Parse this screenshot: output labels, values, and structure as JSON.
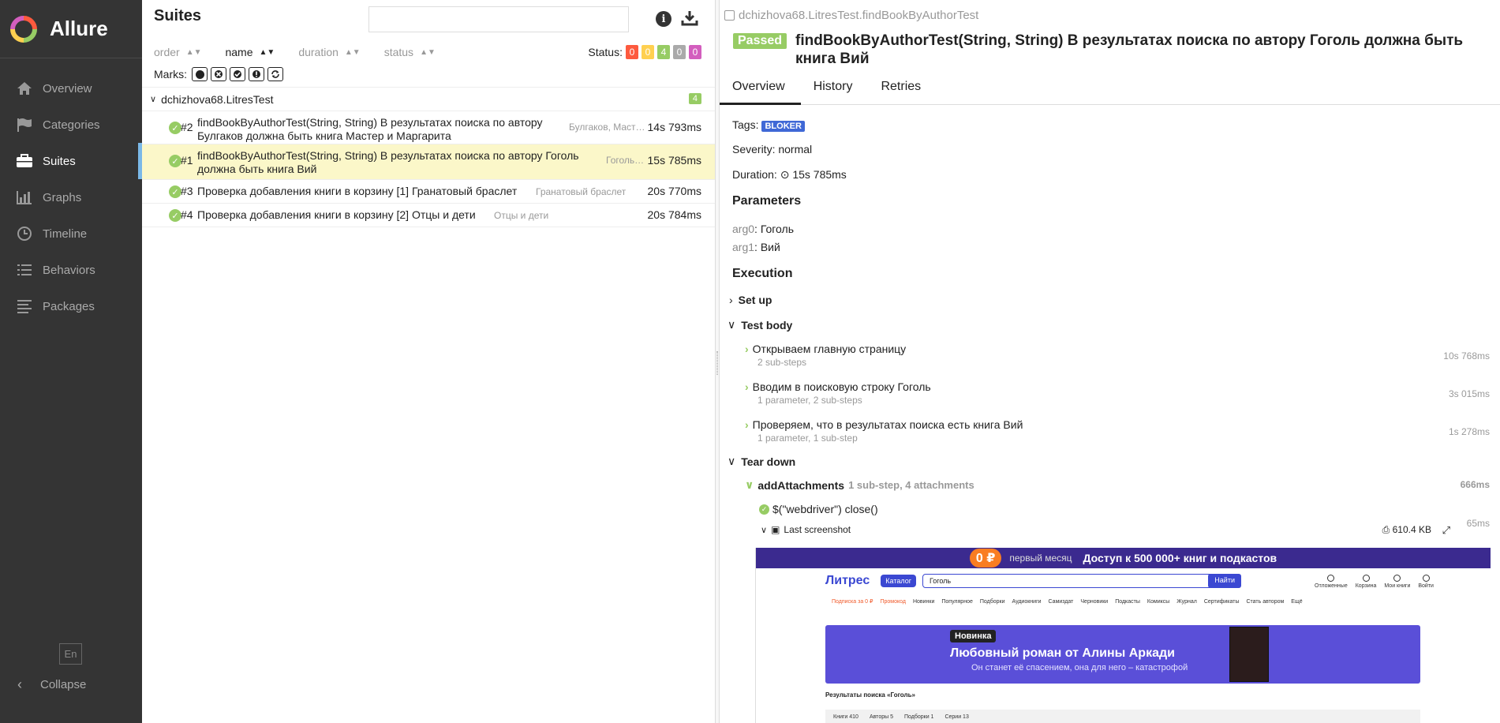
{
  "app": {
    "name": "Allure"
  },
  "sidebar": {
    "items": [
      {
        "label": "Overview",
        "icon": "home-icon"
      },
      {
        "label": "Categories",
        "icon": "flag-icon"
      },
      {
        "label": "Suites",
        "icon": "briefcase-icon",
        "active": true
      },
      {
        "label": "Graphs",
        "icon": "bar-chart-icon"
      },
      {
        "label": "Timeline",
        "icon": "clock-icon"
      },
      {
        "label": "Behaviors",
        "icon": "list-icon"
      },
      {
        "label": "Packages",
        "icon": "align-left-icon"
      }
    ],
    "language": "En",
    "collapse_label": "Collapse"
  },
  "tree": {
    "title": "Suites",
    "search": {
      "value": "",
      "placeholder": ""
    },
    "sorters": [
      "order",
      "name",
      "duration",
      "status"
    ],
    "active_sorter": "name",
    "status_label": "Status:",
    "status_counts": [
      {
        "value": "0",
        "color": "#fd5a3e"
      },
      {
        "value": "0",
        "color": "#ffd050"
      },
      {
        "value": "4",
        "color": "#97cc64"
      },
      {
        "value": "0",
        "color": "#aaaaaa"
      },
      {
        "value": "0",
        "color": "#d35ebe"
      }
    ],
    "marks_label": "Marks:",
    "group": {
      "name": "dchizhova68.LitresTest",
      "count": "4"
    },
    "rows": [
      {
        "num": "#2",
        "name": "findBookByAuthorTest(String, String) В результатах поиска по автору Булгаков должна быть книга Мастер и Маргарита",
        "params": "Булгаков, Маст…",
        "duration": "14s 793ms"
      },
      {
        "num": "#1",
        "name": "findBookByAuthorTest(String, String) В результатах поиска по автору Гоголь должна быть книга Вий",
        "params": "Гоголь…",
        "duration": "15s 785ms",
        "selected": true
      },
      {
        "num": "#3",
        "name": "Проверка добавления книги в корзину [1] Гранатовый браслет",
        "params": "Гранатовый браслет",
        "duration": "20s 770ms"
      },
      {
        "num": "#4",
        "name": "Проверка добавления книги в корзину [2] Отцы и дети",
        "params": "Отцы и дети",
        "duration": "20s 784ms"
      }
    ]
  },
  "details": {
    "breadcrumb": "dchizhova68.LitresTest.findBookByAuthorTest",
    "status": "Passed",
    "title": "findBookByAuthorTest(String, String) В результатах поиска по автору Гоголь должна быть книга Вий",
    "tabs": [
      "Overview",
      "History",
      "Retries"
    ],
    "tags_label": "Tags:",
    "tag": "BLOKER",
    "severity": "Severity: normal",
    "duration_label": "Duration:",
    "duration": "15s 785ms",
    "parameters_heading": "Parameters",
    "params": [
      {
        "key": "arg0",
        "value": "Гоголь"
      },
      {
        "key": "arg1",
        "value": "Вий"
      }
    ],
    "execution_heading": "Execution",
    "setup_label": "Set up",
    "test_body_label": "Test body",
    "steps": [
      {
        "name": "Открываем главную страницу",
        "sub": "2 sub-steps",
        "time": "10s 768ms"
      },
      {
        "name": "Вводим в поисковую строку Гоголь",
        "sub": "1 parameter, 2 sub-steps",
        "time": "3s 015ms"
      },
      {
        "name": "Проверяем, что в результатах поиска есть книга Вий",
        "sub": "1 parameter, 1 sub-step",
        "time": "1s 278ms"
      }
    ],
    "teardown_label": "Tear down",
    "attachments_step": {
      "name": "addAttachments",
      "meta": "1 sub-step, 4 attachments",
      "time": "666ms"
    },
    "close_step": "$(\"webdriver\") close()",
    "screenshot": {
      "name": "Last screenshot",
      "size": "610.4 KB",
      "time": "65ms"
    }
  },
  "screenshot_content": {
    "banner_price": "0 ₽",
    "banner_small": "первый месяц",
    "banner_text": "Доступ к 500 000+ книг и подкастов",
    "logo": "Литрес",
    "catalog": "Каталог",
    "search_value": "Гоголь",
    "find": "Найти",
    "icons": [
      "Отложенные",
      "Корзина",
      "Мои книги",
      "Войти"
    ],
    "menu_hot": [
      "Подписка за 0 ₽",
      "Промокод"
    ],
    "menu": [
      "Новинки",
      "Популярное",
      "Подборки",
      "Аудиокниги",
      "Самиздат",
      "Черновики",
      "Подкасты",
      "Комиксы",
      "Журнал",
      "Сертификаты",
      "Стать автором",
      "Ещё"
    ],
    "promo_badge": "Новинка",
    "promo_title": "Любовный роман от Алины Аркади",
    "promo_sub": "Он станет её спасением, она для него – катастрофой",
    "results_title": "Результаты поиска «Гоголь»",
    "result_tabs": [
      "Книги 410",
      "Авторы 5",
      "Подборки 1",
      "Серии 13"
    ]
  }
}
